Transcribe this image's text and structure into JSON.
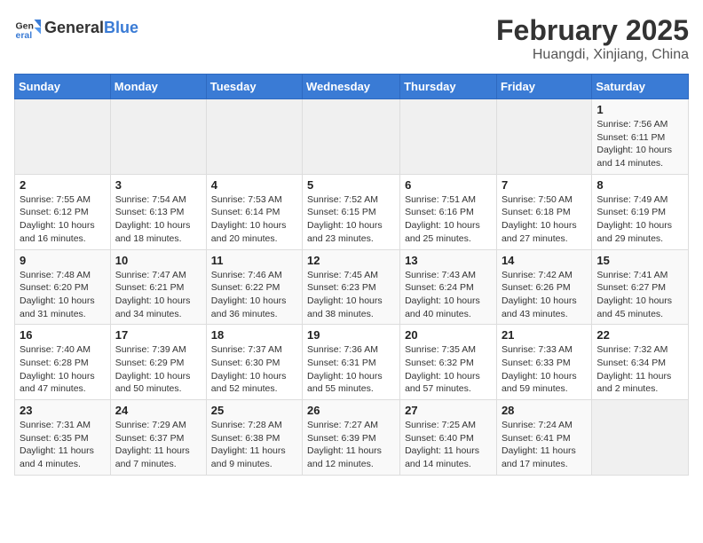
{
  "header": {
    "logo_general": "General",
    "logo_blue": "Blue",
    "title": "February 2025",
    "subtitle": "Huangdi, Xinjiang, China"
  },
  "weekdays": [
    "Sunday",
    "Monday",
    "Tuesday",
    "Wednesday",
    "Thursday",
    "Friday",
    "Saturday"
  ],
  "weeks": [
    [
      {
        "day": "",
        "info": ""
      },
      {
        "day": "",
        "info": ""
      },
      {
        "day": "",
        "info": ""
      },
      {
        "day": "",
        "info": ""
      },
      {
        "day": "",
        "info": ""
      },
      {
        "day": "",
        "info": ""
      },
      {
        "day": "1",
        "info": "Sunrise: 7:56 AM\nSunset: 6:11 PM\nDaylight: 10 hours and 14 minutes."
      }
    ],
    [
      {
        "day": "2",
        "info": "Sunrise: 7:55 AM\nSunset: 6:12 PM\nDaylight: 10 hours and 16 minutes."
      },
      {
        "day": "3",
        "info": "Sunrise: 7:54 AM\nSunset: 6:13 PM\nDaylight: 10 hours and 18 minutes."
      },
      {
        "day": "4",
        "info": "Sunrise: 7:53 AM\nSunset: 6:14 PM\nDaylight: 10 hours and 20 minutes."
      },
      {
        "day": "5",
        "info": "Sunrise: 7:52 AM\nSunset: 6:15 PM\nDaylight: 10 hours and 23 minutes."
      },
      {
        "day": "6",
        "info": "Sunrise: 7:51 AM\nSunset: 6:16 PM\nDaylight: 10 hours and 25 minutes."
      },
      {
        "day": "7",
        "info": "Sunrise: 7:50 AM\nSunset: 6:18 PM\nDaylight: 10 hours and 27 minutes."
      },
      {
        "day": "8",
        "info": "Sunrise: 7:49 AM\nSunset: 6:19 PM\nDaylight: 10 hours and 29 minutes."
      }
    ],
    [
      {
        "day": "9",
        "info": "Sunrise: 7:48 AM\nSunset: 6:20 PM\nDaylight: 10 hours and 31 minutes."
      },
      {
        "day": "10",
        "info": "Sunrise: 7:47 AM\nSunset: 6:21 PM\nDaylight: 10 hours and 34 minutes."
      },
      {
        "day": "11",
        "info": "Sunrise: 7:46 AM\nSunset: 6:22 PM\nDaylight: 10 hours and 36 minutes."
      },
      {
        "day": "12",
        "info": "Sunrise: 7:45 AM\nSunset: 6:23 PM\nDaylight: 10 hours and 38 minutes."
      },
      {
        "day": "13",
        "info": "Sunrise: 7:43 AM\nSunset: 6:24 PM\nDaylight: 10 hours and 40 minutes."
      },
      {
        "day": "14",
        "info": "Sunrise: 7:42 AM\nSunset: 6:26 PM\nDaylight: 10 hours and 43 minutes."
      },
      {
        "day": "15",
        "info": "Sunrise: 7:41 AM\nSunset: 6:27 PM\nDaylight: 10 hours and 45 minutes."
      }
    ],
    [
      {
        "day": "16",
        "info": "Sunrise: 7:40 AM\nSunset: 6:28 PM\nDaylight: 10 hours and 47 minutes."
      },
      {
        "day": "17",
        "info": "Sunrise: 7:39 AM\nSunset: 6:29 PM\nDaylight: 10 hours and 50 minutes."
      },
      {
        "day": "18",
        "info": "Sunrise: 7:37 AM\nSunset: 6:30 PM\nDaylight: 10 hours and 52 minutes."
      },
      {
        "day": "19",
        "info": "Sunrise: 7:36 AM\nSunset: 6:31 PM\nDaylight: 10 hours and 55 minutes."
      },
      {
        "day": "20",
        "info": "Sunrise: 7:35 AM\nSunset: 6:32 PM\nDaylight: 10 hours and 57 minutes."
      },
      {
        "day": "21",
        "info": "Sunrise: 7:33 AM\nSunset: 6:33 PM\nDaylight: 10 hours and 59 minutes."
      },
      {
        "day": "22",
        "info": "Sunrise: 7:32 AM\nSunset: 6:34 PM\nDaylight: 11 hours and 2 minutes."
      }
    ],
    [
      {
        "day": "23",
        "info": "Sunrise: 7:31 AM\nSunset: 6:35 PM\nDaylight: 11 hours and 4 minutes."
      },
      {
        "day": "24",
        "info": "Sunrise: 7:29 AM\nSunset: 6:37 PM\nDaylight: 11 hours and 7 minutes."
      },
      {
        "day": "25",
        "info": "Sunrise: 7:28 AM\nSunset: 6:38 PM\nDaylight: 11 hours and 9 minutes."
      },
      {
        "day": "26",
        "info": "Sunrise: 7:27 AM\nSunset: 6:39 PM\nDaylight: 11 hours and 12 minutes."
      },
      {
        "day": "27",
        "info": "Sunrise: 7:25 AM\nSunset: 6:40 PM\nDaylight: 11 hours and 14 minutes."
      },
      {
        "day": "28",
        "info": "Sunrise: 7:24 AM\nSunset: 6:41 PM\nDaylight: 11 hours and 17 minutes."
      },
      {
        "day": "",
        "info": ""
      }
    ]
  ]
}
